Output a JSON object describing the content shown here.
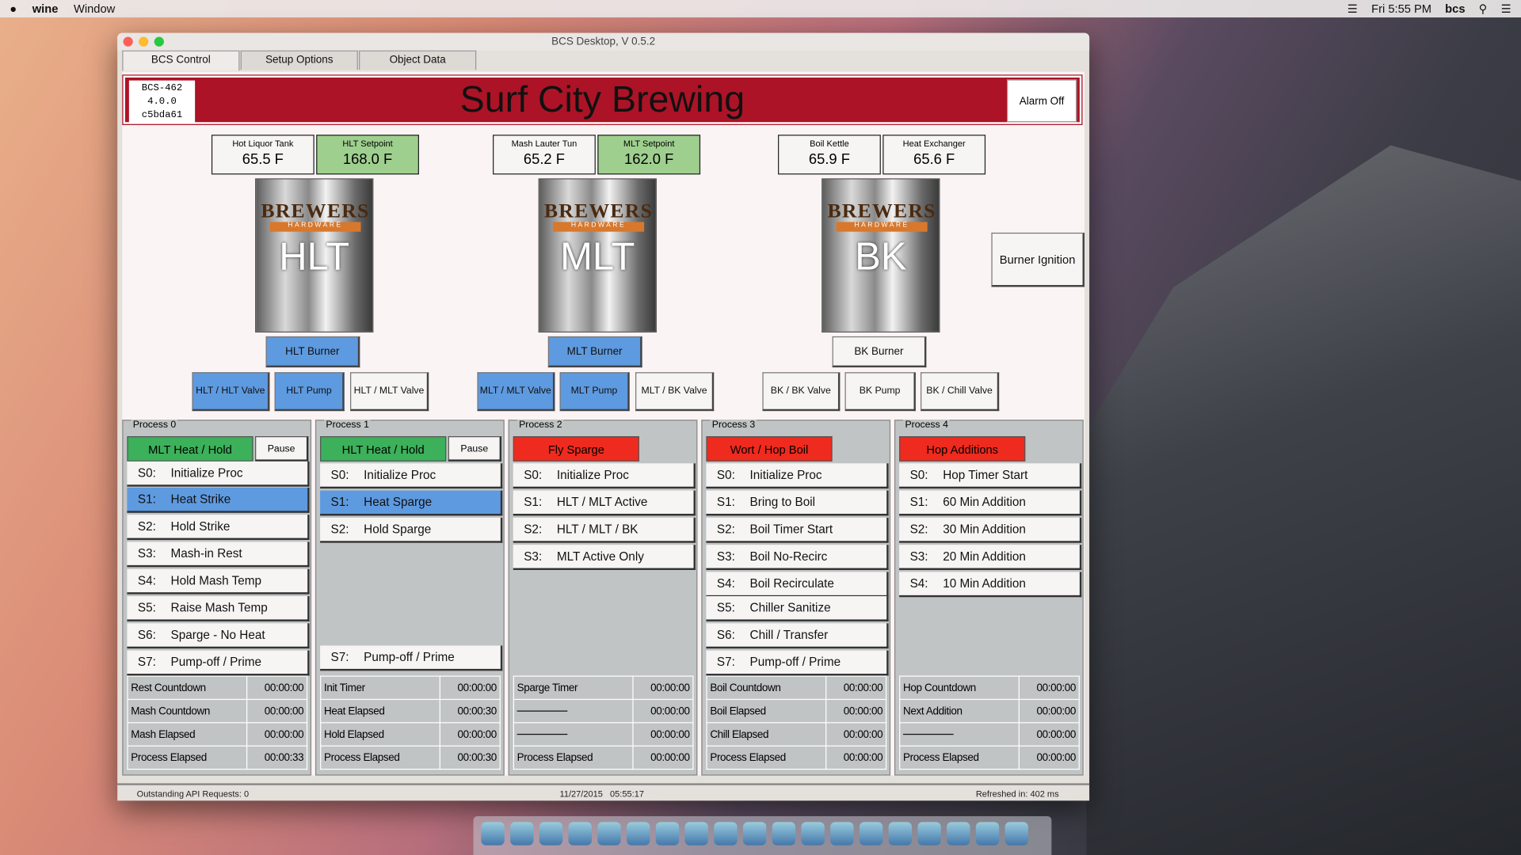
{
  "menubar": {
    "app": "wine",
    "menu": "Window",
    "clock": "Fri 5:55 PM",
    "user": "bcs"
  },
  "window": {
    "title": "BCS Desktop, V 0.5.2"
  },
  "tabs": [
    {
      "label": "BCS Control",
      "active": true
    },
    {
      "label": "Setup Options"
    },
    {
      "label": "Object Data"
    }
  ],
  "banner": {
    "model": "BCS-462",
    "firmware": "4.0.0",
    "build": "c5bda61",
    "brand": "Surf City Brewing",
    "alarm": "Alarm Off",
    "color": "#ac1326"
  },
  "sensors": [
    {
      "label": "Hot Liquor Tank",
      "value": "65.5 F"
    },
    {
      "label": "HLT Setpoint",
      "value": "168.0 F",
      "setpoint": true
    },
    {
      "label": "Mash Lauter Tun",
      "value": "65.2 F"
    },
    {
      "label": "MLT Setpoint",
      "value": "162.0 F",
      "setpoint": true
    },
    {
      "label": "Boil Kettle",
      "value": "65.9 F"
    },
    {
      "label": "Heat Exchanger",
      "value": "65.6 F"
    }
  ],
  "kettles": [
    {
      "name": "HLT",
      "logo": "BREWERS",
      "band": "HARDWARE"
    },
    {
      "name": "MLT",
      "logo": "BREWERS",
      "band": "HARDWARE"
    },
    {
      "name": "BK",
      "logo": "BREWERS",
      "band": "HARDWARE"
    }
  ],
  "burners": [
    {
      "label": "HLT Burner",
      "on": true
    },
    {
      "label": "MLT Burner",
      "on": true
    },
    {
      "label": "BK Burner",
      "on": false
    }
  ],
  "outputs": [
    {
      "label": "HLT / HLT Valve",
      "on": true
    },
    {
      "label": "HLT Pump",
      "on": true
    },
    {
      "label": "HLT / MLT Valve",
      "on": false
    },
    {
      "label": "MLT / MLT Valve",
      "on": true
    },
    {
      "label": "MLT Pump",
      "on": true
    },
    {
      "label": "MLT / BK Valve",
      "on": false
    },
    {
      "label": "BK / BK Valve",
      "on": false
    },
    {
      "label": "BK Pump",
      "on": false
    },
    {
      "label": "BK / Chill Valve",
      "on": false
    }
  ],
  "burner_ignition": "Burner Ignition",
  "processes": [
    {
      "title": "Process 0",
      "name": "MLT Heat / Hold",
      "state": "running",
      "pause": "Pause",
      "active_step": 1,
      "steps": [
        [
          "S0:",
          "Initialize Proc"
        ],
        [
          "S1:",
          "Heat Strike"
        ],
        [
          "S2:",
          "Hold Strike"
        ],
        [
          "S3:",
          "Mash-in Rest"
        ],
        [
          "S4:",
          "Hold Mash Temp"
        ],
        [
          "S5:",
          "Raise Mash Temp"
        ],
        [
          "S6:",
          "Sparge - No Heat"
        ],
        [
          "S7:",
          "Pump-off / Prime"
        ]
      ],
      "timers": [
        [
          "Rest Countdown",
          "00:00:00"
        ],
        [
          "Mash Countdown",
          "00:00:00"
        ],
        [
          "Mash Elapsed",
          "00:00:00"
        ],
        [
          "Process Elapsed",
          "00:00:33"
        ]
      ]
    },
    {
      "title": "Process 1",
      "name": "HLT Heat / Hold",
      "state": "running",
      "pause": "Pause",
      "active_step": 1,
      "steps": [
        [
          "S0:",
          "Initialize Proc"
        ],
        [
          "S1:",
          "Heat Sparge"
        ],
        [
          "S2:",
          "Hold Sparge"
        ],
        null,
        null,
        null,
        null,
        [
          "S7:",
          "Pump-off / Prime"
        ]
      ],
      "timers": [
        [
          "Init Timer",
          "00:00:00"
        ],
        [
          "Heat Elapsed",
          "00:00:30"
        ],
        [
          "Hold Elapsed",
          "00:00:00"
        ],
        [
          "Process Elapsed",
          "00:00:30"
        ]
      ]
    },
    {
      "title": "Process 2",
      "name": "Fly Sparge",
      "state": "stopped",
      "active_step": -1,
      "steps": [
        [
          "S0:",
          "Initialize Proc"
        ],
        [
          "S1:",
          "HLT / MLT Active"
        ],
        [
          "S2:",
          "HLT / MLT / BK"
        ],
        [
          "S3:",
          "MLT Active Only"
        ]
      ],
      "timers": [
        [
          "Sparge Timer",
          "00:00:00"
        ],
        [
          "",
          "00:00:00"
        ],
        [
          "",
          "00:00:00"
        ],
        [
          "Process Elapsed",
          "00:00:00"
        ]
      ]
    },
    {
      "title": "Process 3",
      "name": "Wort / Hop Boil",
      "state": "stopped",
      "active_step": -1,
      "steps": [
        [
          "S0:",
          "Initialize Proc"
        ],
        [
          "S1:",
          "Bring to Boil"
        ],
        [
          "S2:",
          "Boil Timer Start"
        ],
        [
          "S3:",
          "Boil No-Recirc"
        ],
        [
          "S4:",
          "Boil Recirculate"
        ],
        [
          "S5:",
          "Chiller Sanitize"
        ],
        [
          "S6:",
          "Chill / Transfer"
        ],
        [
          "S7:",
          "Pump-off / Prime"
        ]
      ],
      "timers": [
        [
          "Boil Countdown",
          "00:00:00"
        ],
        [
          "Boil Elapsed",
          "00:00:00"
        ],
        [
          "Chill Elapsed",
          "00:00:00"
        ],
        [
          "Process Elapsed",
          "00:00:00"
        ]
      ]
    },
    {
      "title": "Process 4",
      "name": "Hop Additions",
      "state": "stopped",
      "active_step": -1,
      "steps": [
        [
          "S0:",
          "Hop Timer Start"
        ],
        [
          "S1:",
          "60 Min Addition"
        ],
        [
          "S2:",
          "30 Min Addition"
        ],
        [
          "S3:",
          "20 Min Addition"
        ],
        [
          "S4:",
          "10 Min Addition"
        ]
      ],
      "timers": [
        [
          "Hop Countdown",
          "00:00:00"
        ],
        [
          "Next Addition",
          "00:00:00"
        ],
        [
          "",
          "00:00:00"
        ],
        [
          "Process Elapsed",
          "00:00:00"
        ]
      ]
    }
  ],
  "status": {
    "api": "Outstanding API Requests: 0",
    "datetime": "11/27/2015   05:55:17",
    "refresh": "Refreshed in: 402 ms"
  },
  "colors": {
    "running": "#3cb05a",
    "stopped": "#ef2a1e",
    "active_output": "#5e9ae0",
    "setpoint": "#9fcf8f"
  }
}
